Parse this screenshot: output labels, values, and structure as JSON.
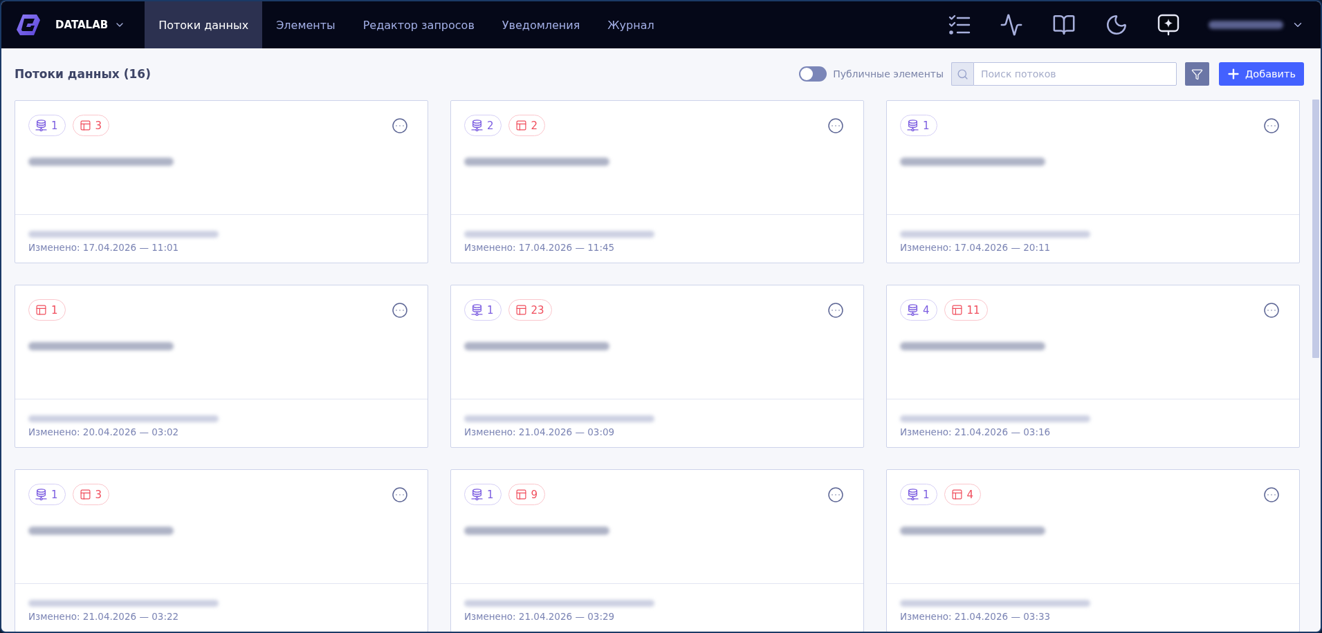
{
  "app": {
    "name": "DATALAB"
  },
  "nav": {
    "tabs": [
      {
        "label": "Потоки данных",
        "selected": true
      },
      {
        "label": "Элементы",
        "selected": false
      },
      {
        "label": "Редактор запросов",
        "selected": false
      },
      {
        "label": "Уведомления",
        "selected": false
      },
      {
        "label": "Журнал",
        "selected": false
      }
    ]
  },
  "header": {
    "title": "Потоки данных (16)"
  },
  "toolbar": {
    "public_toggle": {
      "label": "Публичные элементы",
      "on": false
    },
    "search": {
      "placeholder": "Поиск потоков"
    },
    "add_button": {
      "label": "Добавить"
    }
  },
  "cards": [
    {
      "badges": [
        {
          "kind": "database",
          "count": "1"
        },
        {
          "kind": "table",
          "count": "3"
        }
      ],
      "modified": "Изменено: 17.04.2026 — 11:01"
    },
    {
      "badges": [
        {
          "kind": "database",
          "count": "2"
        },
        {
          "kind": "table",
          "count": "2"
        }
      ],
      "modified": "Изменено: 17.04.2026 — 11:45"
    },
    {
      "badges": [
        {
          "kind": "database",
          "count": "1"
        }
      ],
      "modified": "Изменено: 17.04.2026 — 20:11"
    },
    {
      "badges": [
        {
          "kind": "table",
          "count": "1"
        }
      ],
      "modified": "Изменено: 20.04.2026 — 03:02"
    },
    {
      "badges": [
        {
          "kind": "database",
          "count": "1"
        },
        {
          "kind": "table",
          "count": "23"
        }
      ],
      "modified": "Изменено: 21.04.2026 — 03:09"
    },
    {
      "badges": [
        {
          "kind": "database",
          "count": "4"
        },
        {
          "kind": "table",
          "count": "11"
        }
      ],
      "modified": "Изменено: 21.04.2026 — 03:16"
    },
    {
      "badges": [
        {
          "kind": "database",
          "count": "1"
        },
        {
          "kind": "table",
          "count": "3"
        }
      ],
      "modified": "Изменено: 21.04.2026 — 03:22"
    },
    {
      "badges": [
        {
          "kind": "database",
          "count": "1"
        },
        {
          "kind": "table",
          "count": "9"
        }
      ],
      "modified": "Изменено: 21.04.2026 — 03:29"
    },
    {
      "badges": [
        {
          "kind": "database",
          "count": "1"
        },
        {
          "kind": "table",
          "count": "4"
        }
      ],
      "modified": "Изменено: 21.04.2026 — 03:33"
    }
  ]
}
